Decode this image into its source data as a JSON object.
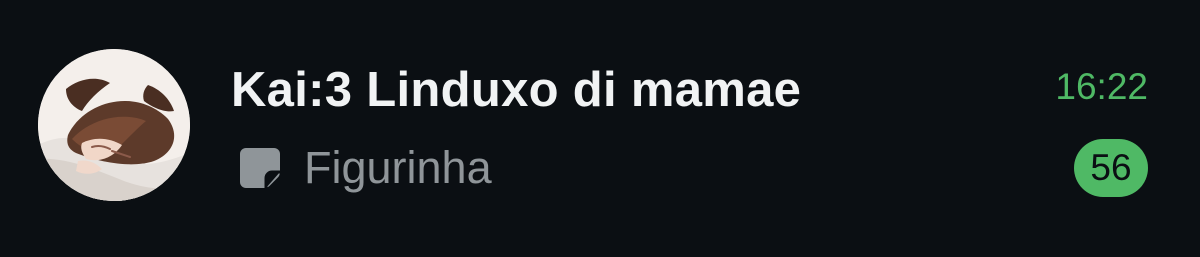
{
  "chat": {
    "name": "Kai:3 Linduxo di mamae",
    "time": "16:22",
    "unread_count": "56",
    "preview": {
      "icon": "sticker-icon",
      "text": "Figurinha"
    },
    "avatar": {
      "icon": "profile-avatar"
    }
  },
  "colors": {
    "background": "#0b0f13",
    "title": "#f1f3f4",
    "preview_text": "#8f9599",
    "accent_green": "#4fb965"
  }
}
